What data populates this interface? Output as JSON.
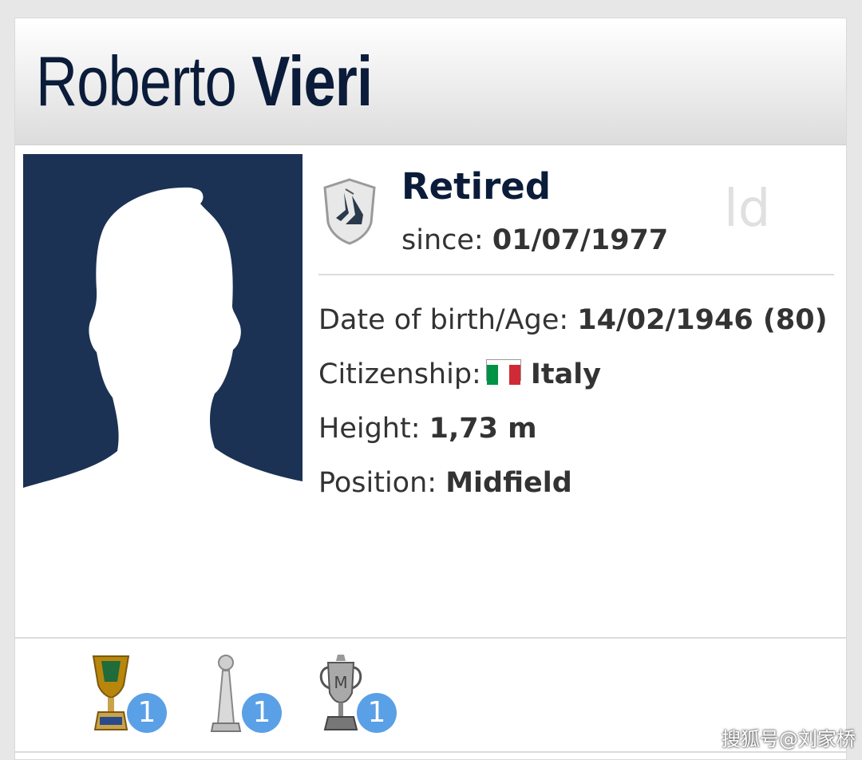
{
  "player": {
    "first_name": "Roberto",
    "last_name": "Vieri"
  },
  "status": {
    "title": "Retired",
    "since_label": "since:",
    "since_date": "01/07/1977",
    "icon": "retired-boots-shield-icon",
    "watermark": "ld"
  },
  "details": {
    "dob_label": "Date of birth/Age:",
    "dob_value": "14/02/1946 (80)",
    "citizenship_label": "Citizenship:",
    "citizenship_value": "Italy",
    "flag_colors": [
      "#009246",
      "#ffffff",
      "#ce2b37"
    ],
    "height_label": "Height:",
    "height_value": "1,73 m",
    "position_label": "Position:",
    "position_value": "Midfield"
  },
  "photo": {
    "background_color": "#1b3254",
    "icon": "player-silhouette-icon"
  },
  "trophies": [
    {
      "icon": "gold-cup-trophy-icon",
      "count": "1"
    },
    {
      "icon": "silver-tower-trophy-icon",
      "count": "1"
    },
    {
      "icon": "silver-handled-cup-trophy-icon",
      "count": "1"
    }
  ],
  "watermark": "搜狐号@刘家桥",
  "colors": {
    "name_color": "#0b1c3a",
    "badge_color": "#5aa0e6"
  }
}
